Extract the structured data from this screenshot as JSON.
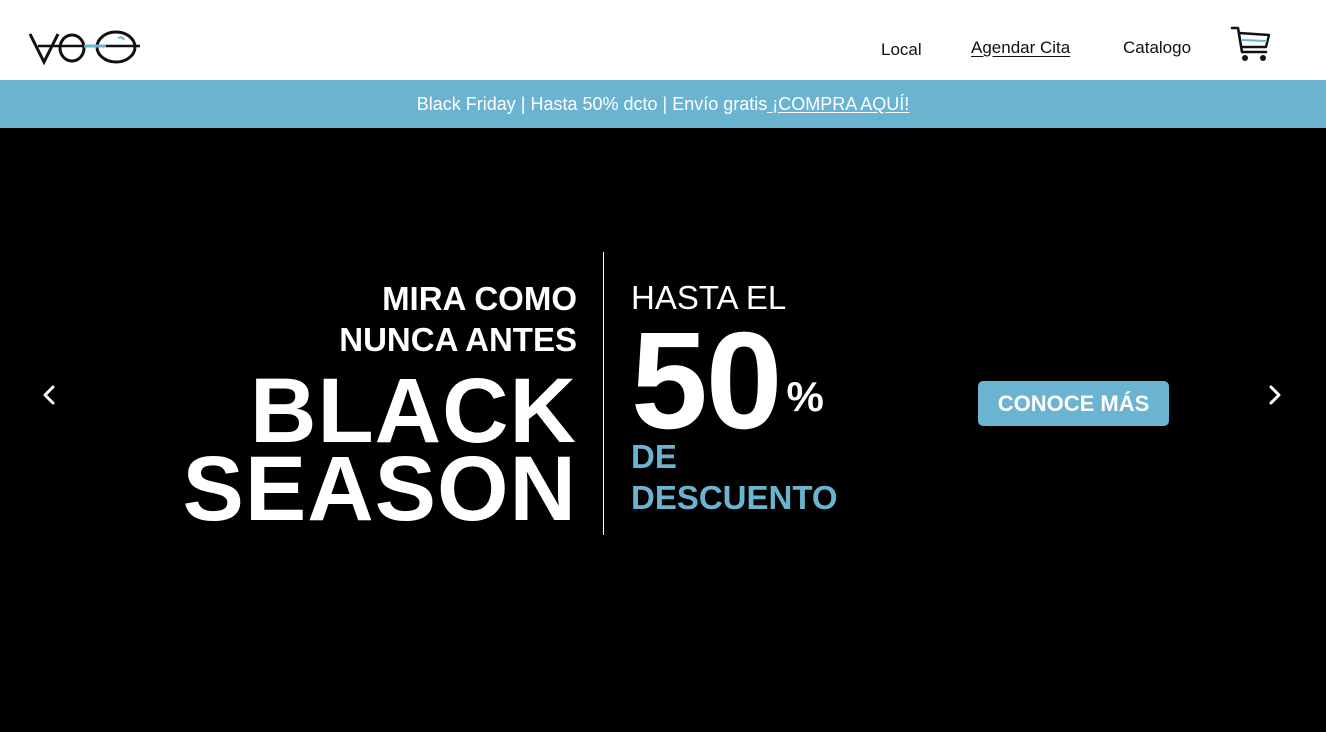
{
  "brand": {
    "logo_text": "VEO",
    "accent": "#6ab3d1"
  },
  "nav": {
    "local": "Local",
    "agendar": "Agendar Cita",
    "catalogo": "Catalogo",
    "cart_icon": "cart-icon"
  },
  "promo": {
    "text": "Black Friday | Hasta 50% dcto | Envío gratis",
    "link": " ¡COMPRA AQUÍ!",
    "background": "#6ab3d1"
  },
  "hero": {
    "line1": "MIRA COMO",
    "line2": "NUNCA ANTES",
    "big1": "BLACK",
    "big2": "SEASON",
    "hasta": "HASTA EL",
    "number": "50",
    "percent": "%",
    "de": "DE",
    "descuento": "DESCUENTO",
    "cta": "CONOCE MÁS",
    "prev_icon": "chevron-left-icon",
    "next_icon": "chevron-right-icon",
    "background": "#000000"
  }
}
